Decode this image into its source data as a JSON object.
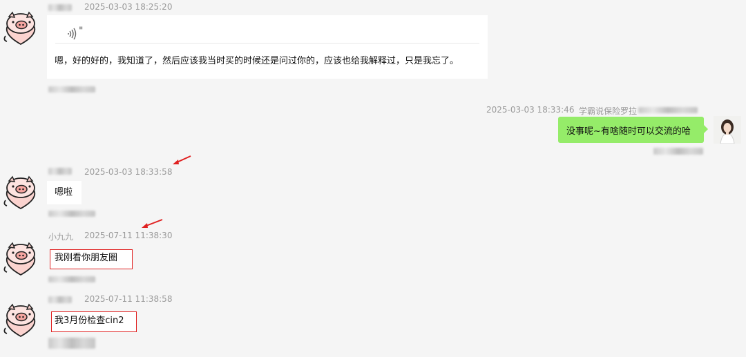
{
  "messages": [
    {
      "time": "2025-03-03 18:25:20",
      "sender": "",
      "voice_mark": "\"",
      "text": "嗯，好的好的，我知道了，然后应该我当时买的时候还是问过你的，应该也给我解释过，只是我忘了。"
    },
    {
      "time": "2025-03-03 18:33:46",
      "sender": "学霸说保险罗拉",
      "text": "没事呢~有啥随时可以交流的哈"
    },
    {
      "time": "2025-03-03 18:33:58",
      "sender": "",
      "text": "嗯啦"
    },
    {
      "time": "2025-07-11 11:38:30",
      "sender": "小九九",
      "text": "我刚看你朋友圈"
    },
    {
      "time": "2025-07-11 11:38:58",
      "sender": "",
      "text": "我3月份检查cin2"
    }
  ],
  "colors": {
    "accent_green": "#95ec69",
    "annotation_red": "#e02020",
    "background": "#f5f5f5"
  },
  "icons": {
    "left_avatar": "pig-heart-avatar",
    "right_avatar": "woman-photo-avatar",
    "voice": "voice-wave-icon",
    "annotation": "red-arrow-icon"
  }
}
